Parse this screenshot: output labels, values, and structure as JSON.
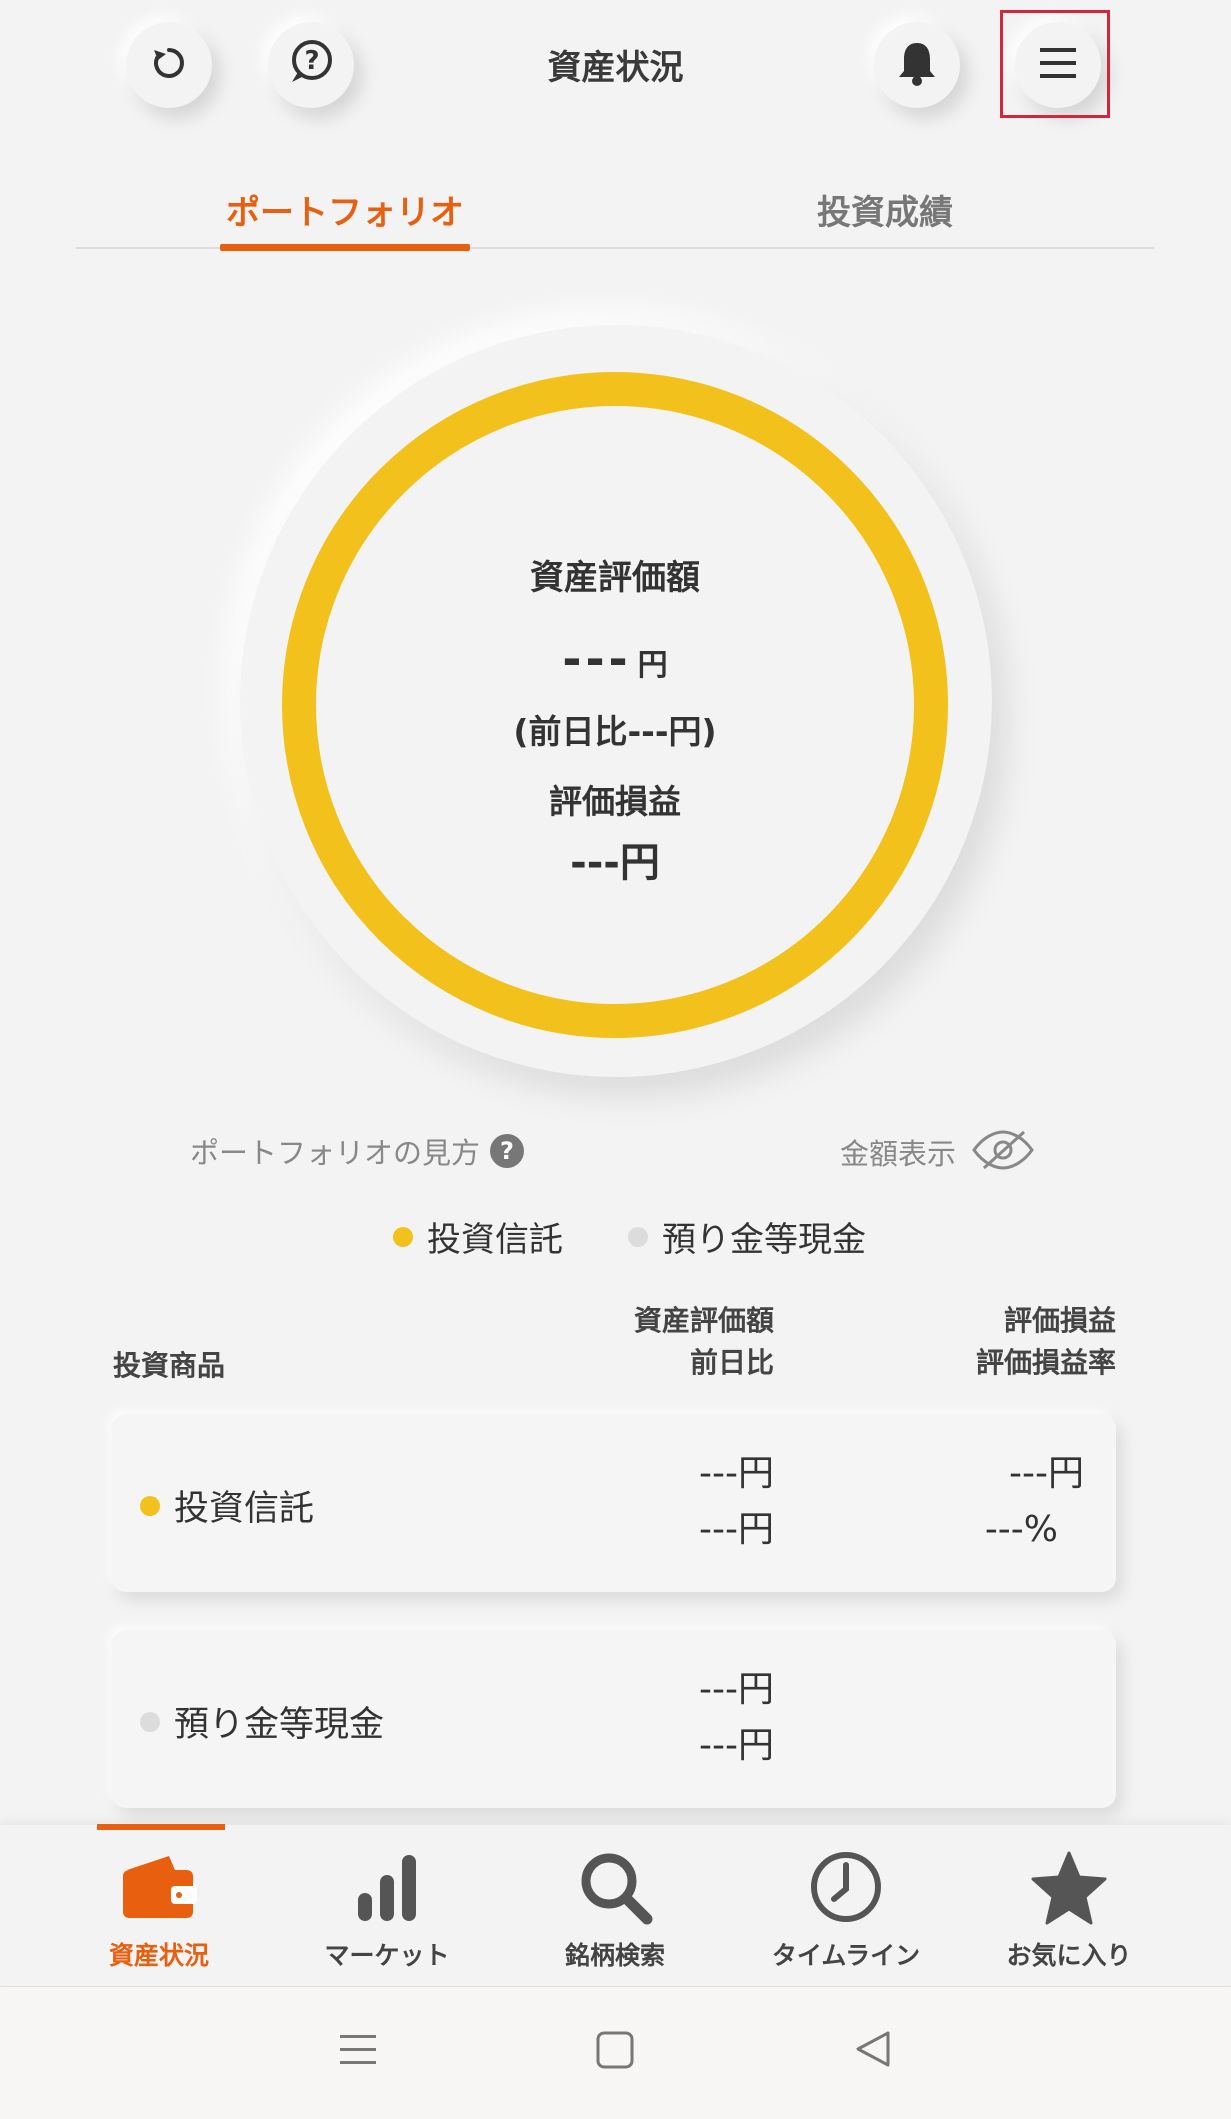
{
  "header": {
    "title": "資産状況",
    "icons": [
      "refresh-icon",
      "help-chat-icon",
      "bell-icon",
      "menu-icon"
    ]
  },
  "tabs": [
    {
      "label": "ポートフォリオ",
      "active": true
    },
    {
      "label": "投資成績",
      "active": false
    }
  ],
  "summary": {
    "asset_label": "資産評価額",
    "asset_value": "---",
    "asset_unit": "円",
    "day_change": "(前日比---円)",
    "pl_label": "評価損益",
    "pl_value": "---円"
  },
  "links": {
    "portfolio_help": "ポートフォリオの見方",
    "show_amount": "金額表示"
  },
  "legend": [
    {
      "label": "投資信託",
      "color": "#f3c11b"
    },
    {
      "label": "預り金等現金",
      "color": "#dcdcdc"
    }
  ],
  "table": {
    "col_product": "投資商品",
    "col_value_1": "資産評価額",
    "col_value_2": "前日比",
    "col_pl_1": "評価損益",
    "col_pl_2": "評価損益率",
    "rows": [
      {
        "name": "投資信託",
        "color": "#f3c11b",
        "value": "---円",
        "change": "---円",
        "pl": "---円",
        "pl_rate": "---%"
      },
      {
        "name": "預り金等現金",
        "color": "#dcdcdc",
        "value": "---円",
        "change": "---円"
      }
    ]
  },
  "nav": [
    {
      "label": "資産状況",
      "icon": "wallet-icon",
      "active": true
    },
    {
      "label": "マーケット",
      "icon": "bar-chart-icon",
      "active": false
    },
    {
      "label": "銘柄検索",
      "icon": "search-icon",
      "active": false
    },
    {
      "label": "タイムライン",
      "icon": "clock-icon",
      "active": false
    },
    {
      "label": "お気に入り",
      "icon": "star-icon",
      "active": false
    }
  ],
  "colors": {
    "accent": "#e8600f",
    "ring": "#f3c11b",
    "highlight": "#d3263b"
  }
}
